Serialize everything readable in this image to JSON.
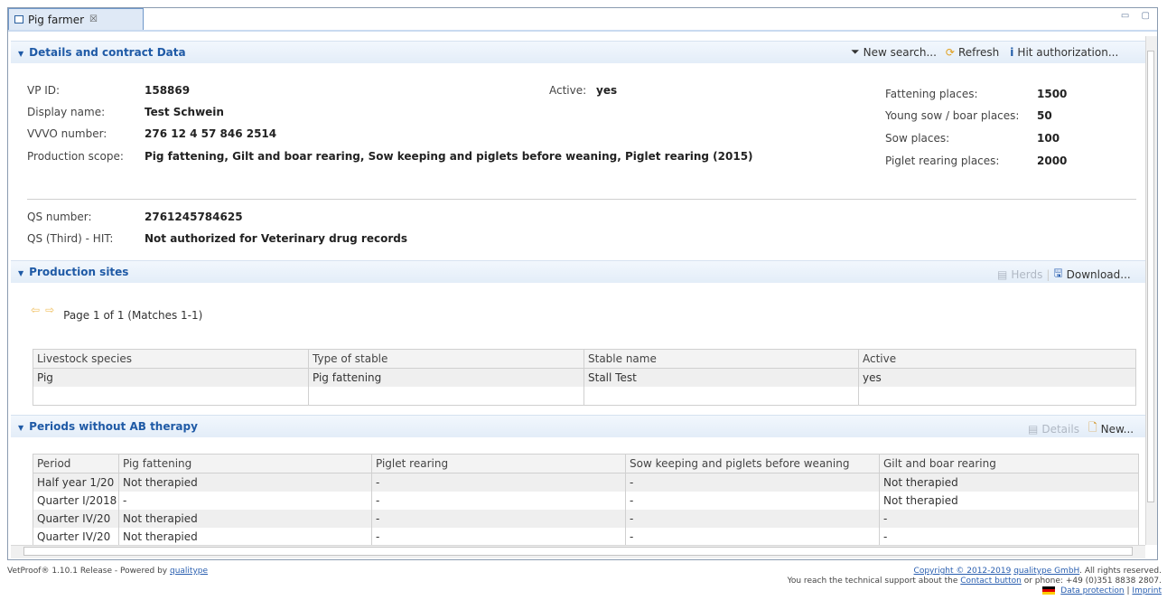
{
  "tab": {
    "title": "Pig farmer",
    "close": "☒"
  },
  "window_controls": "▭ ▢",
  "details": {
    "section_title": "Details and contract Data",
    "toolbar": {
      "new_search": "New search...",
      "refresh": "Refresh",
      "hit_authorization": "Hit authorization..."
    },
    "vp_id_label": "VP ID:",
    "vp_id": "158869",
    "display_name_label": "Display name:",
    "display_name": "Test Schwein",
    "vvvo_label": "VVVO number:",
    "vvvo": "276 12 4 57 846 2514",
    "production_scope_label": "Production scope:",
    "production_scope": "Pig fattening, Gilt and boar rearing, Sow keeping and piglets before weaning, Piglet rearing (2015)",
    "active_label": "Active:",
    "active": "yes",
    "fattening_label": "Fattening places:",
    "fattening": "1500",
    "young_sow_label": "Young sow / boar places:",
    "young_sow": "50",
    "sow_label": "Sow places:",
    "sow": "100",
    "piglet_label": "Piglet rearing places:",
    "piglet": "2000",
    "qs_number_label": "QS number:",
    "qs_number": "2761245784625",
    "qs_hit_label": "QS (Third) - HIT:",
    "qs_hit": "Not authorized for Veterinary drug records"
  },
  "production_sites": {
    "section_title": "Production sites",
    "toolbar": {
      "herds": "Herds",
      "download": "Download..."
    },
    "pager": "Page 1 of 1 (Matches 1-1)",
    "columns": [
      "Livestock species",
      "Type of stable",
      "Stable name",
      "Active"
    ],
    "rows": [
      [
        "Pig",
        "Pig fattening",
        "Stall Test",
        "yes"
      ]
    ]
  },
  "periods": {
    "section_title": "Periods without AB therapy",
    "toolbar": {
      "details": "Details",
      "new": "New..."
    },
    "columns": [
      "Period",
      "Pig fattening",
      "Piglet rearing",
      "Sow keeping and piglets before weaning",
      "Gilt and boar rearing"
    ],
    "rows": [
      [
        "Half year 1/20",
        "Not therapied",
        "-",
        "-",
        "Not therapied"
      ],
      [
        "Quarter I/2018",
        "-",
        "-",
        "-",
        "Not therapied"
      ],
      [
        "Quarter IV/20",
        "Not therapied",
        "-",
        "-",
        "-"
      ],
      [
        "Quarter IV/20",
        "Not therapied",
        "-",
        "-",
        "-"
      ]
    ]
  },
  "footer": {
    "left_prefix": "VetProof® 1.10.1 Release - Powered by ",
    "left_link": "qualitype",
    "copyright_link": "Copyright © 2012-2019",
    "company_link": "qualitype GmbH",
    "rights": ". All rights reserved.",
    "support_prefix": "You reach the technical support about the ",
    "contact_link": "Contact button",
    "support_suffix": " or phone: +49 (0)351 8838 2807.",
    "data_protection": "Data protection",
    "separator": "|",
    "imprint": "Imprint"
  },
  "colors": {
    "accent": "#1f5aa6",
    "link": "#2a5fb0",
    "header_bg": "#e8f0f9"
  }
}
